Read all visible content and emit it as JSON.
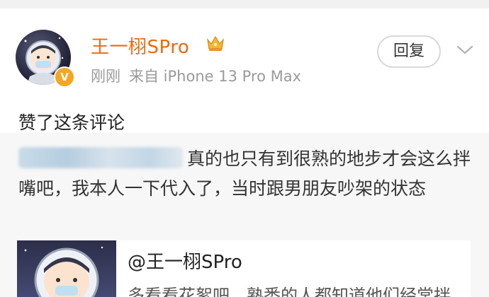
{
  "post": {
    "user": {
      "name": "王一栩SPro",
      "badge_label": "V"
    },
    "meta": {
      "time": "刚刚",
      "source": "来自 iPhone 13 Pro Max"
    },
    "reply_label": "回复",
    "action_text": "赞了这条评论"
  },
  "quoted_comment": {
    "text": "真的也只有到很熟的地步才会这么拌嘴吧，我本人一下代入了，当时跟男朋友吵架的状态"
  },
  "referenced_post": {
    "title": "@王一栩SPro",
    "snippet": "多看看花絮吧，熟悉的人都知道他们经常拌"
  },
  "colors": {
    "username": "#ed6a0e",
    "badge": "#f5a623",
    "meta_text": "#9a9a9a"
  }
}
